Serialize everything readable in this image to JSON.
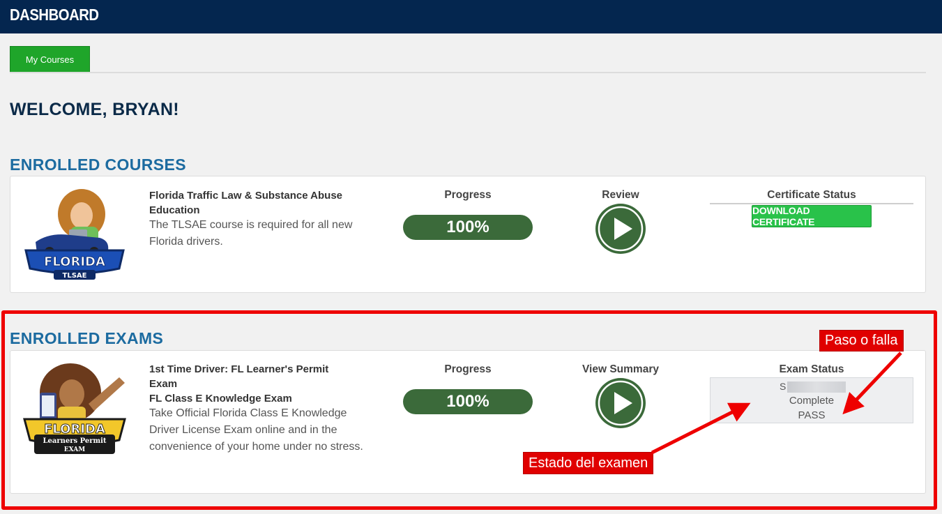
{
  "header": {
    "title": "DASHBOARD"
  },
  "tabs": [
    {
      "label": "My Courses"
    }
  ],
  "welcome": "WELCOME, BRYAN!",
  "enrolled_courses": {
    "section_title": "ENROLLED COURSES",
    "course": {
      "logo_text": [
        "FLORIDA",
        "TLSAE"
      ],
      "title": "Florida Traffic Law & Substance Abuse Education",
      "description": "The TLSAE course is required for all new Florida drivers.",
      "progress_label": "Progress",
      "progress_value": "100%",
      "progress_fraction": 1.0,
      "review_label": "Review",
      "certificate_label": "Certificate Status",
      "download_label": "DOWNLOAD CERTIFICATE"
    }
  },
  "enrolled_exams": {
    "section_title": "ENROLLED EXAMS",
    "exam": {
      "logo_text": [
        "FLORIDA",
        "Learners Permit",
        "EXAM"
      ],
      "title_1": "1st Time Driver: FL Learner's Permit Exam",
      "title_2": "FL Class E Knowledge Exam",
      "description": "Take Official Florida Class E Knowledge Driver License Exam online and in the convenience of your home under no stress.",
      "progress_label": "Progress",
      "progress_value": "100%",
      "progress_fraction": 1.0,
      "summary_label": "View Summary",
      "status_label": "Exam Status",
      "status_initial": "S",
      "status_line_1": "Complete",
      "status_line_2": "PASS"
    }
  },
  "annotations": {
    "pass_fail": "Paso o falla",
    "exam_status": "Estado del examen"
  },
  "colors": {
    "header_bg": "#04264f",
    "tab_green": "#1fa52a",
    "section_blue": "#1c6ba0",
    "progress_green": "#3b6a3a",
    "download_green": "#29c24a",
    "annotation_red": "#e00000"
  }
}
